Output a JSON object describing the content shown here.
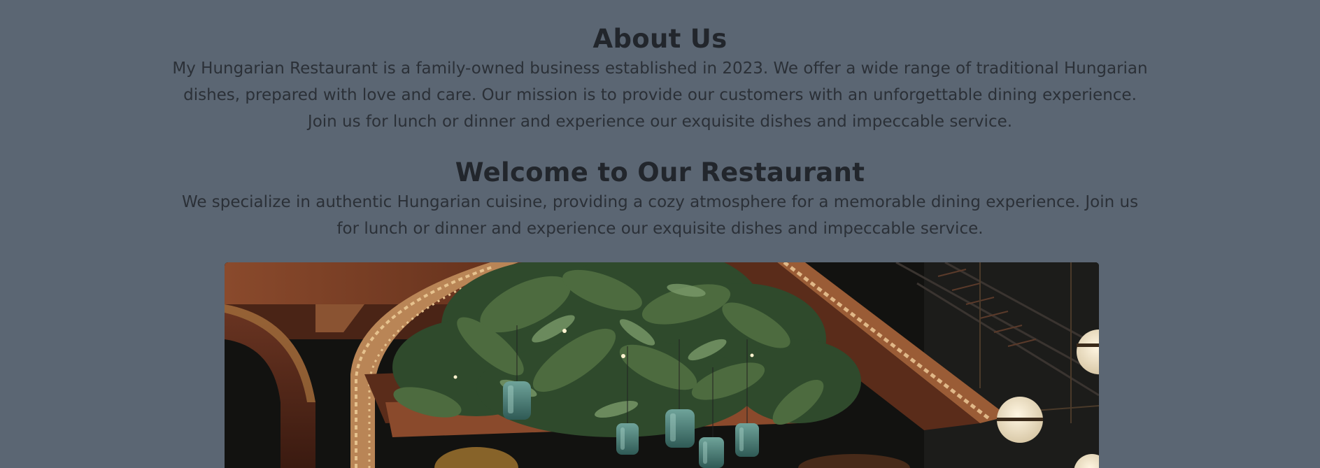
{
  "about": {
    "title": "About Us",
    "text": "My Hungarian Restaurant is a family-owned business established in 2023. We offer a wide range of traditional Hungarian dishes, prepared with love and care. Our mission is to provide our customers with an unforgettable dining experience. Join us for lunch or dinner and experience our exquisite dishes and impeccable service."
  },
  "welcome": {
    "title": "Welcome to Our Restaurant",
    "text": "We specialize in authentic Hungarian cuisine, providing a cozy atmosphere for a memorable dining experience. Join us for lunch or dinner and experience our exquisite dishes and impeccable service."
  },
  "hero_image": {
    "description_icon": "restaurant-interior-photo"
  },
  "colors": {
    "background": "#5b6673",
    "heading": "#22262c",
    "text": "#2b3037"
  }
}
